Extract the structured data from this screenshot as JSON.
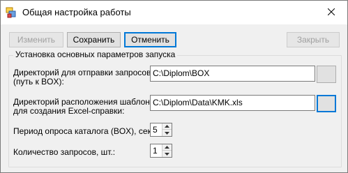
{
  "window": {
    "title": "Общая настройка работы",
    "icons": {
      "app": "app-settings-icon",
      "close": "close-icon"
    }
  },
  "toolbar": {
    "edit_label": "Изменить",
    "save_label": "Сохранить",
    "cancel_label": "Отменить",
    "close_label": "Закрыть"
  },
  "group": {
    "title": "Установка основных параметров запуска",
    "send_dir": {
      "label_line1": "Директорий для отправки запросов",
      "label_line2": "(путь к BOX):",
      "value": "C:\\Diplom\\BOX"
    },
    "template_dir": {
      "label_line1": "Директорий расположения шаблона",
      "label_line2": "для создания Excel-справки:",
      "value": "C:\\Diplom\\Data\\KMK.xls"
    },
    "poll_period": {
      "label": "Период опроса каталога (BOX), сек.:",
      "value": "5"
    },
    "request_count": {
      "label": "Количество запросов, шт.:",
      "value": "1"
    }
  },
  "colors": {
    "accent": "#0078d7",
    "window_bg": "#f0f0f0",
    "titlebar_bg": "#ffffff",
    "disabled_text": "#a0a0a0"
  }
}
